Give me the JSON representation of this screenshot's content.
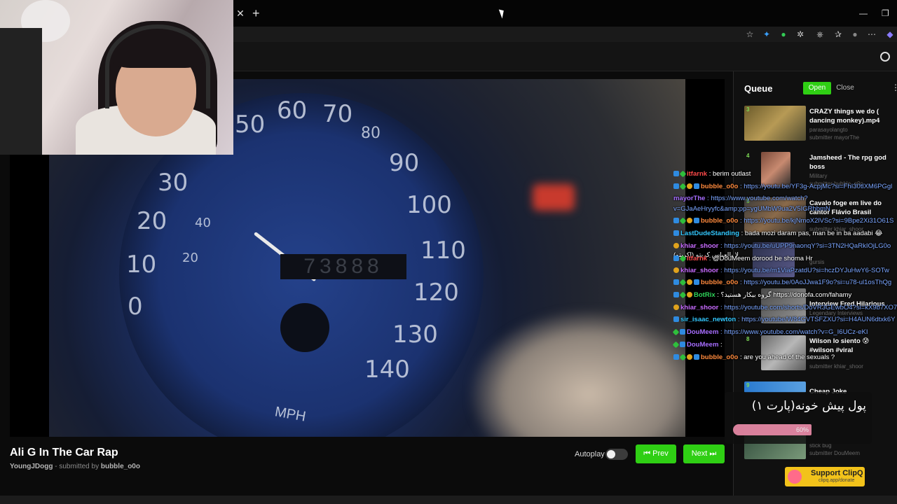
{
  "video": {
    "title": "Ali G In The Car Rap",
    "author": "YoungJDogg",
    "submitted_prefix": "- submitted by",
    "submitter": "bubble_o0o",
    "gauge_numbers": [
      "60",
      "70",
      "50",
      "80",
      "90",
      "30",
      "100",
      "20",
      "40",
      "110",
      "10",
      "20",
      "120",
      "0",
      "130",
      "140"
    ],
    "odometer": "73888",
    "unit_label": "MPH"
  },
  "controls": {
    "autoplay_label": "Autoplay",
    "prev_label": "Prev",
    "next_label": "Next"
  },
  "queue": {
    "title": "Queue",
    "open_label": "Open",
    "close_label": "Close",
    "items": [
      {
        "num": "3",
        "name": "CRAZY things we do ( dancing monkey).mp4",
        "channel": "parasayolangto",
        "submitter": "submitter mayorThe"
      },
      {
        "num": "4",
        "name": "Jamsheed - The rpg god boss",
        "channel": "Military",
        "submitter": "submitter bubble_o0o"
      },
      {
        "num": "5",
        "name": "Cavalo foge em live do cantor Flávio Brasil",
        "channel": "",
        "submitter": "submitter khiar_shoor"
      },
      {
        "num": "",
        "name": "",
        "channel": "gursis",
        "submitter": ""
      },
      {
        "num": "",
        "name": "Interview Fred Hilarious",
        "channel": "Legendary Interviews",
        "submitter": ""
      },
      {
        "num": "8",
        "name": "Wilson lo siento 😰 #wilson #viral",
        "channel": "",
        "submitter": "submitter khiar_shoor"
      },
      {
        "num": "9",
        "name": "Cheap Joke",
        "channel": "",
        "submitter": ""
      },
      {
        "num": "",
        "name": "",
        "channel": "stick bug",
        "submitter": "submitter DouMeem"
      }
    ]
  },
  "chat": [
    {
      "user": "itfarnk",
      "color": "#ff4a4a",
      "badges": [
        "mod",
        "vip"
      ],
      "text": ": berim outlast",
      "link": false
    },
    {
      "user": "bubble_o0o",
      "color": "#ff8a3d",
      "badges": [
        "mod",
        "vip",
        "sub",
        "mod"
      ],
      "text": ": https://youtu.be/YF3g-AcpjMc?si=FhI30tlXM6PGgl",
      "link": true
    },
    {
      "user": "mayorThe",
      "color": "#a76dff",
      "badges": [],
      "text": ": https://www.youtube.com/watch?",
      "link": true
    },
    {
      "user": "",
      "color": "#ffffff",
      "badges": [],
      "text": "v=GJaAeHryyfc&amp;pp=ygUMbW9ua2V5IGRhbmN",
      "link": true
    },
    {
      "user": "bubble_o0o",
      "color": "#ff8a3d",
      "badges": [
        "mod",
        "vip",
        "sub",
        "mod"
      ],
      "text": ": https://youtu.be/kjNmoX2lVSc?si=9Bpe2Xi31O61S",
      "link": true
    },
    {
      "user": "LastDudeStanding",
      "color": "#33c8ff",
      "badges": [
        "mod"
      ],
      "text": ": bada mozi daram pas, man be in ba aadabi 😂",
      "link": false
    },
    {
      "user": "khiar_shoor",
      "color": "#c86bff",
      "badges": [
        "sub"
      ],
      "text": ": https://youtu.be/uUPP9naonqY?si=3TN2HQaRkIOjLG0o",
      "link": true
    },
    {
      "user": "",
      "color": "#ffffff",
      "badges": [],
      "text": "لا يالعباس كريتو (اكريتو)",
      "link": false
    },
    {
      "user": "itfarnk",
      "color": "#ff4a4a",
      "badges": [
        "mod",
        "vip"
      ],
      "text": ": @DouMeem dorood be shoma Hr",
      "link": false
    },
    {
      "user": "khiar_shoor",
      "color": "#c86bff",
      "badges": [
        "sub"
      ],
      "text": ": https://youtu.be/m1ViaPzatdU?si=hczDYJuHwY6-SOTw",
      "link": true
    },
    {
      "user": "bubble_o0o",
      "color": "#ff8a3d",
      "badges": [
        "mod",
        "vip",
        "sub",
        "mod"
      ],
      "text": ": https://youtu.be/0AoJJwa1F9o?si=u78-ul1osThQg",
      "link": true
    },
    {
      "user": "BotRix",
      "color": "#2fd45a",
      "badges": [
        "mod",
        "vip",
        "sub"
      ],
      "text": ": گروه بیکار هستید؟ https://donofa.com/fahamy",
      "link": false
    },
    {
      "user": "khiar_shoor",
      "color": "#c86bff",
      "badges": [
        "sub"
      ],
      "text": ": https://youtube.com/shorts/DoVR3GEwbO4?si=kX9b7XO7N",
      "link": true
    },
    {
      "user": "sir_isaac_newton",
      "color": "#33c8ff",
      "badges": [
        "mod"
      ],
      "text": ": https://youtube/W84GVTSFZXU?si=H4AUN6dtxk6Y",
      "link": true
    },
    {
      "user": "DouMeem",
      "color": "#a76dff",
      "badges": [
        "vip",
        "mod"
      ],
      "text": ": https://www.youtube.com/watch?v=G_I6UCz-eKI",
      "link": true
    },
    {
      "user": "DouMeem",
      "color": "#a76dff",
      "badges": [
        "vip",
        "mod"
      ],
      "text": ":",
      "link": false
    },
    {
      "user": "bubble_o0o",
      "color": "#ff8a3d",
      "badges": [
        "mod",
        "vip",
        "sub",
        "mod"
      ],
      "text": ": are you ahead of the sexuals ?",
      "link": false
    }
  ],
  "gift": {
    "text": "پول پیش خونه(پارت ۱)",
    "progress_label": "60%",
    "progress": 0.6
  },
  "support": {
    "label": "Support ClipQ",
    "url_text": "clipq.app/donate"
  }
}
